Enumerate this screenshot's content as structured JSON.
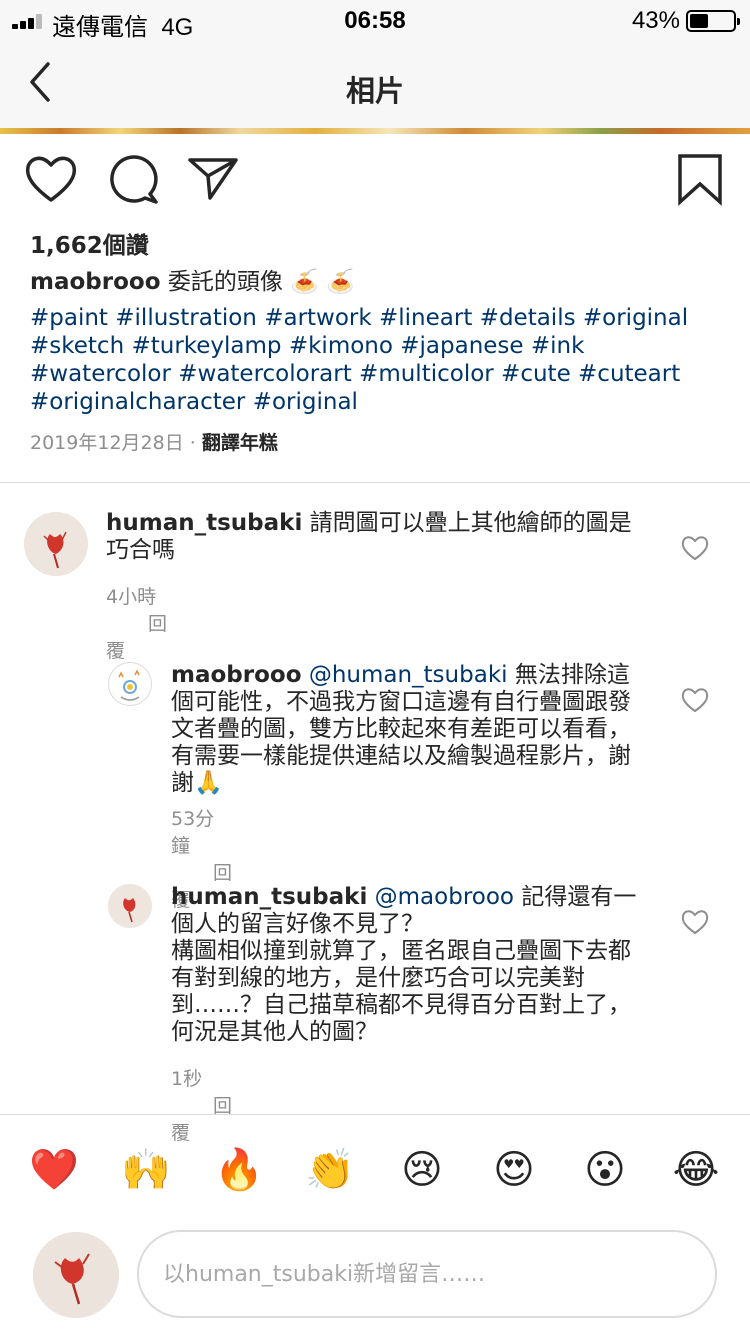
{
  "status_bar": {
    "carrier": "遠傳電信  4G",
    "time": "06:58",
    "battery": "43%",
    "battery_level": 0.43
  },
  "nav": {
    "title": "相片",
    "back_icon": "chevron-left-icon"
  },
  "post": {
    "likes": "1,662個讚",
    "caption_user": "maobrooo",
    "caption_text": "委託的頭像 🍝 🍝",
    "hashtags": "#paint #illustration #artwork #lineart #details #original #sketch #turkeylamp #kimono #japanese #ink #watercolor #watercolorart #multicolor #cute #cuteart #originalcharacter #original",
    "date": "2019年12月28日",
    "separator": " · ",
    "translate": "翻譯年糕"
  },
  "comments": [
    {
      "user": "human_tsubaki",
      "mention": "",
      "text": "請問圖可以疊上其他繪師的圖是巧合嗎",
      "time": "4小時",
      "reply": "回覆"
    },
    {
      "user": "maobrooo",
      "mention": "@human_tsubaki",
      "text": "無法排除這個可能性，不過我方窗口這邊有自行疊圖跟發文者疊的圖，雙方比較起來有差距可以看看，有需要一樣能提供連結以及繪製過程影片，謝謝🙏",
      "time": "53分鐘",
      "reply": "回覆"
    },
    {
      "user": "human_tsubaki",
      "mention": "@maobrooo",
      "text": "記得還有一個人的留言好像不見了？",
      "text2": "構圖相似撞到就算了，匿名跟自己疊圖下去都有對到線的地方，是什麼巧合可以完美對到……？自己描草稿都不見得百分百對上了，何況是其他人的圖？",
      "time": "1秒",
      "reply": "回覆"
    }
  ],
  "emoji_bar": [
    "❤️",
    "🙌",
    "🔥",
    "👏",
    "😢",
    "😍",
    "😮",
    "😂"
  ],
  "input": {
    "placeholder": "以human_tsubaki新增留言……"
  },
  "colors": {
    "link": "#003569",
    "muted": "#8e8e8e",
    "divider": "#dbdbdb"
  }
}
